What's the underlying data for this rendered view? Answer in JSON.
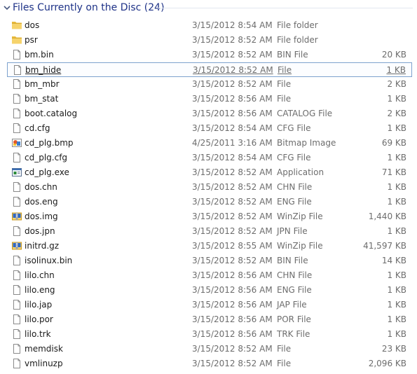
{
  "group": {
    "title": "Files Currently on the Disc (24)"
  },
  "files": [
    {
      "name": "dos",
      "date": "3/15/2012 8:54 AM",
      "type": "File folder",
      "size": "",
      "icon": "folder-icon"
    },
    {
      "name": "psr",
      "date": "3/15/2012 8:52 AM",
      "type": "File folder",
      "size": "",
      "icon": "folder-icon"
    },
    {
      "name": "bm.bin",
      "date": "3/15/2012 8:52 AM",
      "type": "BIN File",
      "size": "20 KB",
      "icon": "document-icon"
    },
    {
      "name": "bm_hide",
      "date": "3/15/2012 8:52 AM",
      "type": "File",
      "size": "1 KB",
      "icon": "document-icon",
      "selected": true
    },
    {
      "name": "bm_mbr",
      "date": "3/15/2012 8:52 AM",
      "type": "File",
      "size": "2 KB",
      "icon": "document-icon"
    },
    {
      "name": "bm_stat",
      "date": "3/15/2012 8:56 AM",
      "type": "File",
      "size": "1 KB",
      "icon": "document-icon"
    },
    {
      "name": "boot.catalog",
      "date": "3/15/2012 8:56 AM",
      "type": "CATALOG File",
      "size": "2 KB",
      "icon": "document-icon"
    },
    {
      "name": "cd.cfg",
      "date": "3/15/2012 8:54 AM",
      "type": "CFG File",
      "size": "1 KB",
      "icon": "document-icon"
    },
    {
      "name": "cd_plg.bmp",
      "date": "4/25/2011 3:16 AM",
      "type": "Bitmap Image",
      "size": "69 KB",
      "icon": "bitmap-image-icon"
    },
    {
      "name": "cd_plg.cfg",
      "date": "3/15/2012 8:54 AM",
      "type": "CFG File",
      "size": "1 KB",
      "icon": "document-icon"
    },
    {
      "name": "cd_plg.exe",
      "date": "3/15/2012 8:52 AM",
      "type": "Application",
      "size": "71 KB",
      "icon": "application-icon"
    },
    {
      "name": "dos.chn",
      "date": "3/15/2012 8:52 AM",
      "type": "CHN File",
      "size": "1 KB",
      "icon": "document-icon"
    },
    {
      "name": "dos.eng",
      "date": "3/15/2012 8:52 AM",
      "type": "ENG File",
      "size": "1 KB",
      "icon": "document-icon"
    },
    {
      "name": "dos.img",
      "date": "3/15/2012 8:52 AM",
      "type": "WinZip File",
      "size": "1,440 KB",
      "icon": "winzip-icon"
    },
    {
      "name": "dos.jpn",
      "date": "3/15/2012 8:52 AM",
      "type": "JPN File",
      "size": "1 KB",
      "icon": "document-icon"
    },
    {
      "name": "initrd.gz",
      "date": "3/15/2012 8:55 AM",
      "type": "WinZip File",
      "size": "41,597 KB",
      "icon": "winzip-icon"
    },
    {
      "name": "isolinux.bin",
      "date": "3/15/2012 8:52 AM",
      "type": "BIN File",
      "size": "14 KB",
      "icon": "document-icon"
    },
    {
      "name": "lilo.chn",
      "date": "3/15/2012 8:56 AM",
      "type": "CHN File",
      "size": "1 KB",
      "icon": "document-icon"
    },
    {
      "name": "lilo.eng",
      "date": "3/15/2012 8:56 AM",
      "type": "ENG File",
      "size": "1 KB",
      "icon": "document-icon"
    },
    {
      "name": "lilo.jap",
      "date": "3/15/2012 8:56 AM",
      "type": "JAP File",
      "size": "1 KB",
      "icon": "document-icon"
    },
    {
      "name": "lilo.por",
      "date": "3/15/2012 8:56 AM",
      "type": "POR File",
      "size": "1 KB",
      "icon": "document-icon"
    },
    {
      "name": "lilo.trk",
      "date": "3/15/2012 8:56 AM",
      "type": "TRK File",
      "size": "1 KB",
      "icon": "document-icon"
    },
    {
      "name": "memdisk",
      "date": "3/15/2012 8:52 AM",
      "type": "File",
      "size": "23 KB",
      "icon": "document-icon"
    },
    {
      "name": "vmlinuzp",
      "date": "3/15/2012 8:52 AM",
      "type": "File",
      "size": "2,096 KB",
      "icon": "document-icon"
    }
  ],
  "colors": {
    "group_title": "#1e3287",
    "selection_border": "#7da2ce",
    "secondary_text": "#6d6d6d"
  }
}
